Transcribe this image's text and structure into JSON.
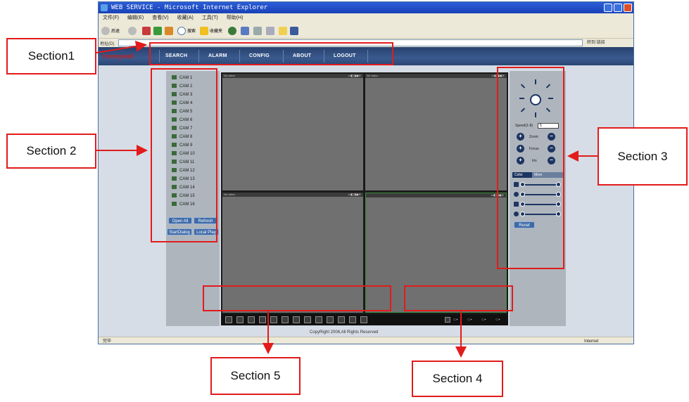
{
  "browser": {
    "window_title": "WEB SERVICE - Microsoft Internet Explorer",
    "menu": [
      "文件(F)",
      "编辑(E)",
      "查看(V)",
      "收藏(A)",
      "工具(T)",
      "帮助(H)"
    ],
    "toolbar": {
      "back_label": "后退",
      "search_label": "搜索",
      "favorites_label": "收藏夹"
    },
    "address_label": "地址(D)",
    "go_label": "转到 链接",
    "status_left": "完毕",
    "status_zone": "Internet"
  },
  "web": {
    "brand": "Honeywell",
    "nav": [
      "SEARCH",
      "ALARM",
      "CONFIG",
      "ABOUT",
      "LOGOUT"
    ],
    "cameras": [
      "CAM 1",
      "CAM 2",
      "CAM 3",
      "CAM 4",
      "CAM 5",
      "CAM 6",
      "CAM 7",
      "CAM 8",
      "CAM 9",
      "CAM 10",
      "CAM 11",
      "CAM 12",
      "CAM 13",
      "CAM 14",
      "CAM 15",
      "CAM 16"
    ],
    "buttons": {
      "open_all": "Open All",
      "refresh": "Refresh",
      "start_dialog": "StartDialog",
      "local_play": "Local Play"
    },
    "video_pane_label": "No video",
    "ptz": {
      "speed_label": "Speed(1-8)",
      "speed_value": "5",
      "zoom": "Zoom",
      "focus": "Focus",
      "iris": "Iris"
    },
    "color_tabs": {
      "color": "Color",
      "more": "More"
    },
    "reset": "Reset",
    "copyright": "CopyRight 2006,All Rights Reserved"
  },
  "annotations": {
    "section1": "Section1",
    "section2": "Section 2",
    "section3": "Section 3",
    "section4": "Section 4",
    "section5": "Section 5"
  },
  "colors": {
    "annotation": "#e21b1b",
    "nav_bar": "#2b4675",
    "panel_bg": "#aeb5bd",
    "video_bg": "#707070"
  }
}
